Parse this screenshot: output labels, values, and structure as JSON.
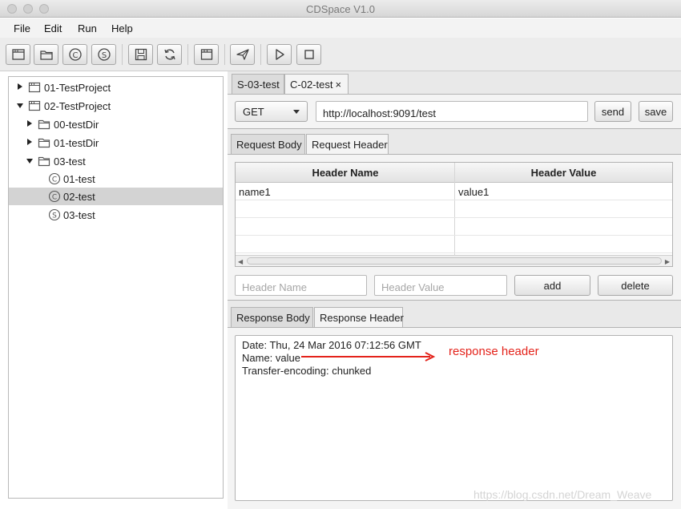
{
  "window": {
    "title": "CDSpace V1.0"
  },
  "menu": [
    "File",
    "Edit",
    "Run",
    "Help"
  ],
  "toolbar": [
    {
      "name": "new-project-icon"
    },
    {
      "name": "open-folder-icon"
    },
    {
      "name": "client-icon"
    },
    {
      "name": "server-icon"
    },
    {
      "name": "save-icon"
    },
    {
      "name": "refresh-icon"
    },
    {
      "name": "window-icon"
    },
    {
      "name": "send-icon"
    },
    {
      "name": "play-icon"
    },
    {
      "name": "stop-icon"
    }
  ],
  "tree": [
    {
      "label": "01-TestProject",
      "icon": "project-icon",
      "arrow": "right"
    },
    {
      "label": "02-TestProject",
      "icon": "project-icon",
      "arrow": "down"
    },
    {
      "label": "00-testDir",
      "icon": "folder-icon",
      "arrow": "right"
    },
    {
      "label": "01-testDir",
      "icon": "folder-icon",
      "arrow": "right"
    },
    {
      "label": "03-test",
      "icon": "folder-icon",
      "arrow": "down"
    },
    {
      "label": "01-test",
      "icon": "client-icon",
      "badge": "C"
    },
    {
      "label": "02-test",
      "icon": "client-icon",
      "badge": "C",
      "selected": true
    },
    {
      "label": "03-test",
      "icon": "server-icon",
      "badge": "S"
    }
  ],
  "editor_tabs": [
    {
      "label": "S-03-test"
    },
    {
      "label": "C-02-test",
      "close": "×",
      "active": true
    }
  ],
  "request": {
    "method": "GET",
    "url": "http://localhost:9091/test",
    "send_label": "send",
    "save_label": "save"
  },
  "request_tabs": [
    "Request Body",
    "Request Header"
  ],
  "header_table": {
    "columns": [
      "Header Name",
      "Header Value"
    ],
    "rows": [
      [
        "name1",
        "value1"
      ]
    ]
  },
  "header_inputs": {
    "name_placeholder": "Header Name",
    "value_placeholder": "Header Value",
    "add_label": "add",
    "delete_label": "delete"
  },
  "response_tabs": [
    "Response Body",
    "Response Header"
  ],
  "response_lines": [
    "Date: Thu, 24 Mar 2016 07:12:56 GMT",
    "Name: value",
    "Transfer-encoding: chunked"
  ],
  "annotation": "response header",
  "watermark": "https://blog.csdn.net/Dream_Weave"
}
